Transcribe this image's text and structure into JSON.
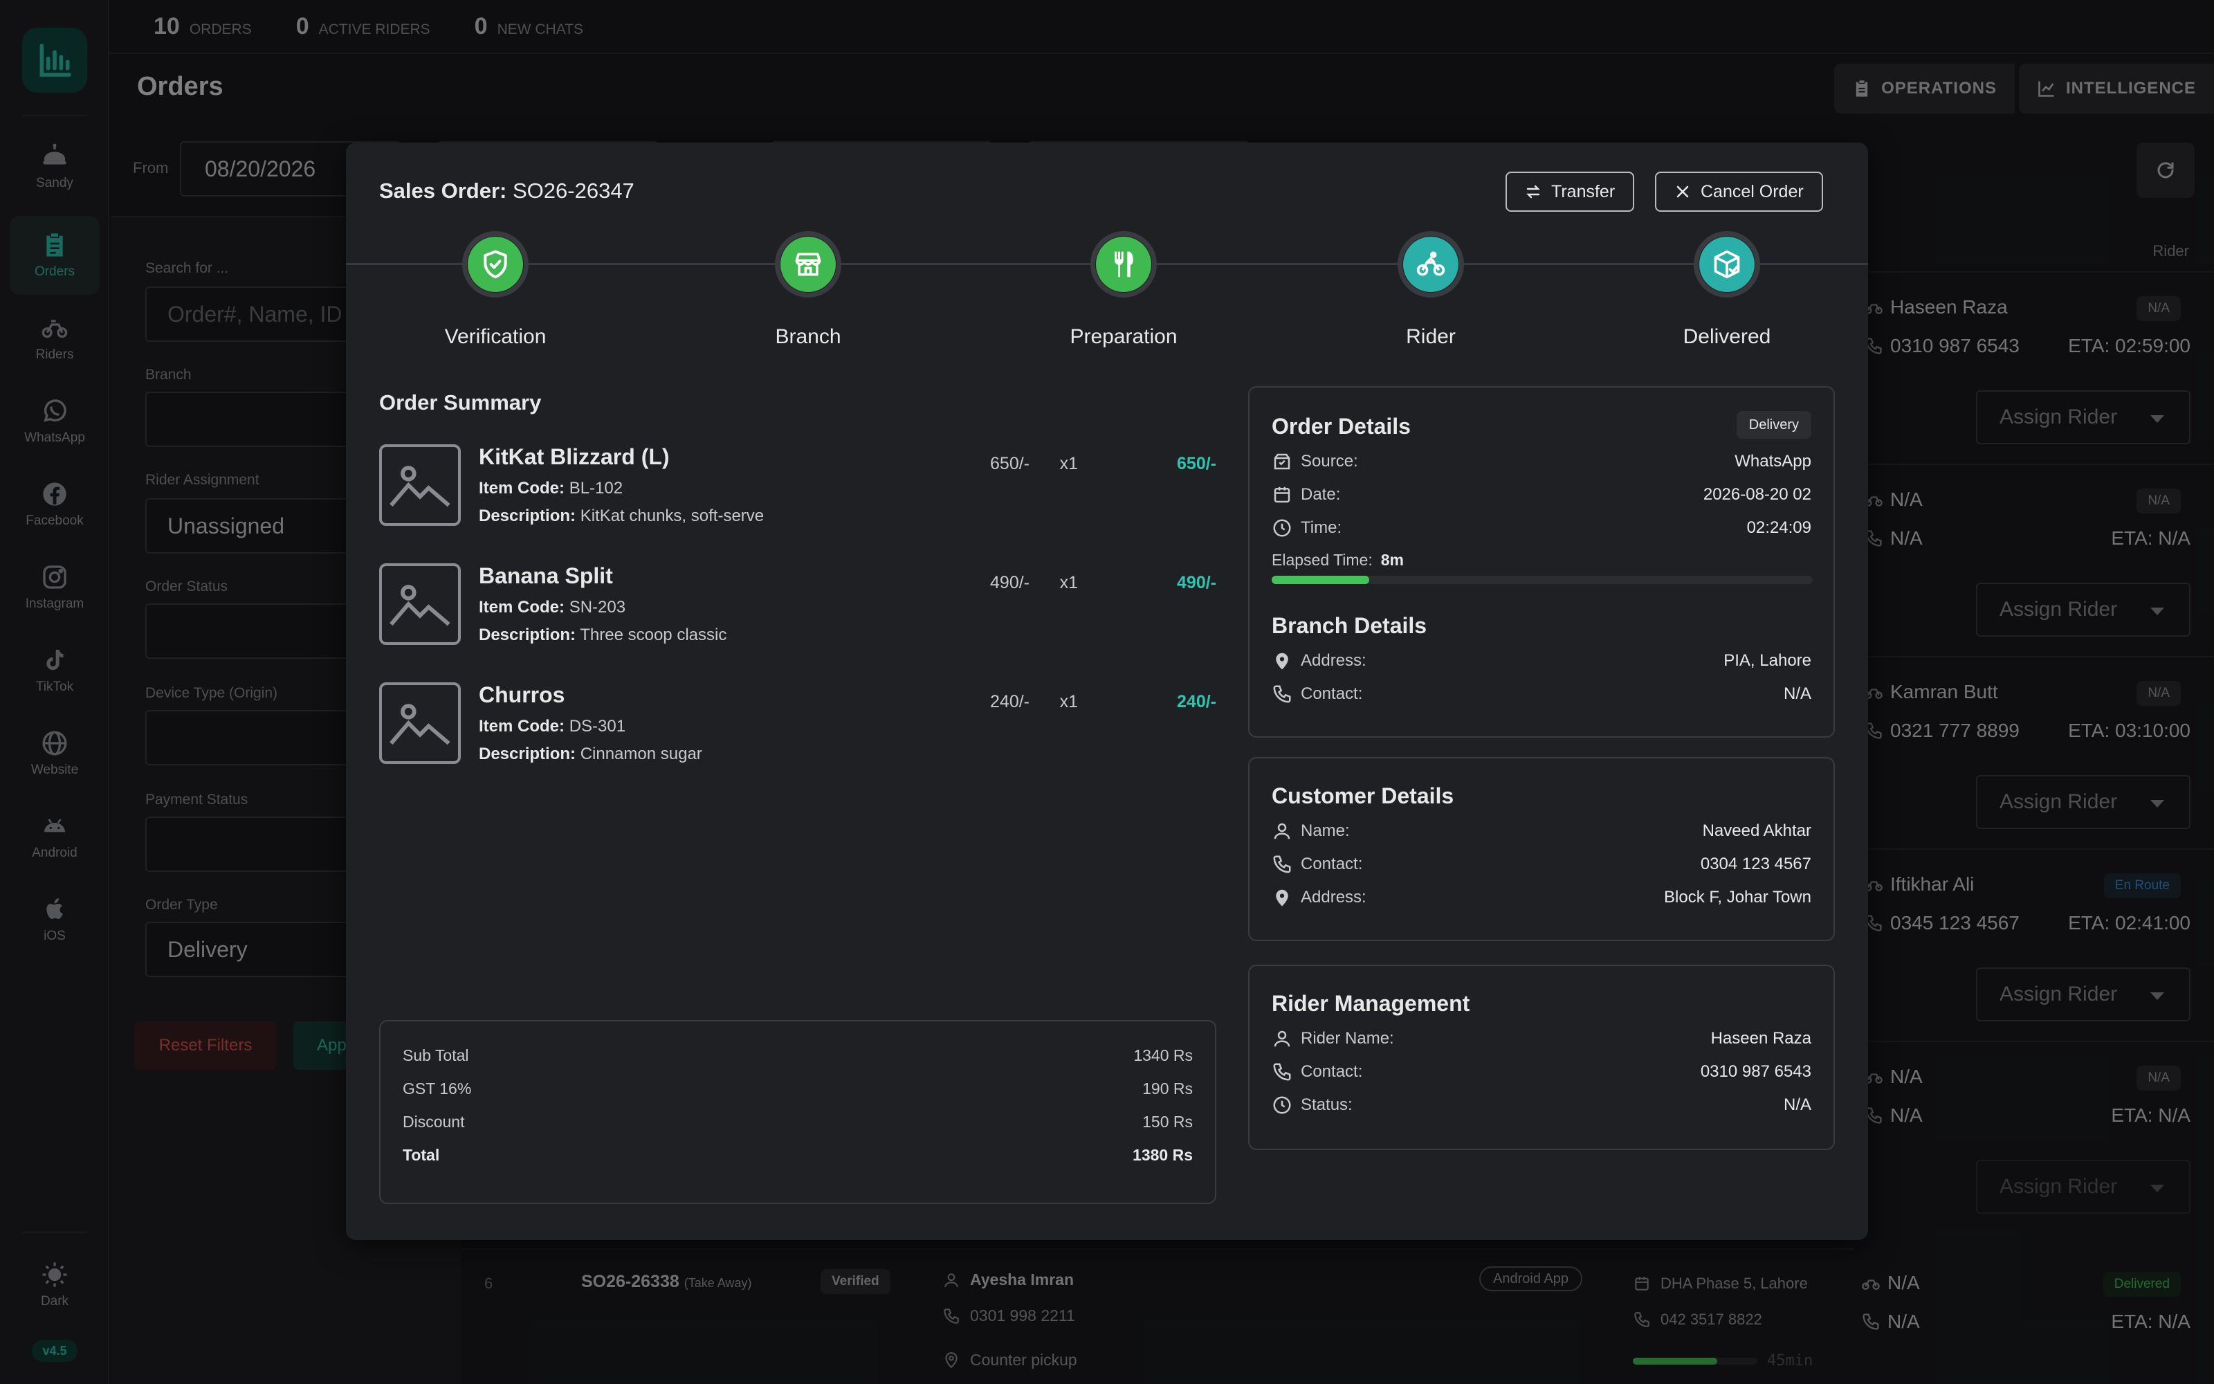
{
  "brand_color": "#2ec4b0",
  "sidebar": {
    "items": [
      {
        "id": "sandy",
        "label": "Sandy",
        "icon": "robot-icon"
      },
      {
        "id": "orders",
        "label": "Orders",
        "icon": "clipboard-icon",
        "active": true
      },
      {
        "id": "riders",
        "label": "Riders",
        "icon": "bicycle-icon"
      },
      {
        "id": "whatsapp",
        "label": "WhatsApp",
        "icon": "whatsapp-icon"
      },
      {
        "id": "facebook",
        "label": "Facebook",
        "icon": "facebook-icon"
      },
      {
        "id": "instagram",
        "label": "Instagram",
        "icon": "instagram-icon"
      },
      {
        "id": "tiktok",
        "label": "TikTok",
        "icon": "tiktok-icon"
      },
      {
        "id": "website",
        "label": "Website",
        "icon": "globe-icon"
      },
      {
        "id": "android",
        "label": "Android",
        "icon": "android-icon"
      },
      {
        "id": "ios",
        "label": "iOS",
        "icon": "apple-icon"
      }
    ],
    "theme_label": "Dark",
    "version": "v4.5"
  },
  "stats": [
    {
      "value": "10",
      "label": "Orders"
    },
    {
      "value": "0",
      "label": "Active Riders"
    },
    {
      "value": "0",
      "label": "New Chats"
    }
  ],
  "header": {
    "title": "Orders",
    "operations_label": "OPERATIONS",
    "intelligence_label": "INTELLIGENCE"
  },
  "date_filter": {
    "from_label": "From",
    "from_value": "08/20/2026"
  },
  "filters": {
    "search_label": "Search for ...",
    "search_placeholder": "Order#, Name, ID",
    "branch_label": "Branch",
    "rider_label": "Rider Assignment",
    "rider_value": "Unassigned",
    "status_label": "Order Status",
    "device_label": "Device Type (Origin)",
    "payment_label": "Payment Status",
    "type_label": "Order Type",
    "type_value": "Delivery",
    "reset_label": "Reset Filters",
    "apply_label": "App"
  },
  "list": {
    "rider_col_label": "Rider",
    "assign_label": "Assign Rider",
    "rows": [
      {
        "rider": "Haseen Raza",
        "phone": "0310 987 6543",
        "eta": "ETA: 02:59:00",
        "badge": "N/A",
        "badge_kind": "na"
      },
      {
        "rider": "N/A",
        "phone": "N/A",
        "eta": "ETA: N/A",
        "badge": "N/A",
        "badge_kind": "na"
      },
      {
        "rider": "Kamran Butt",
        "phone": "0321 777 8899",
        "eta": "ETA: 03:10:00",
        "badge": "N/A",
        "badge_kind": "na"
      },
      {
        "rider": "Iftikhar Ali",
        "phone": "0345 123 4567",
        "eta": "ETA: 02:41:00",
        "badge": "En Route",
        "badge_kind": "enroute"
      },
      {
        "rider": "N/A",
        "phone": "N/A",
        "eta": "ETA: N/A",
        "badge": "N/A",
        "badge_kind": "na"
      }
    ],
    "bottom_row": {
      "index": "6",
      "order_no": "SO26-26338",
      "order_type": "(Take Away)",
      "status": "Verified",
      "customer": "Ayesha Imran",
      "phone": "0301 998 2211",
      "address": "Counter pickup",
      "source": "Android App",
      "branch": "DHA Phase 5, Lahore",
      "branch_phone": "042 3517 8822",
      "elapsed": "45min",
      "progress": 0.68,
      "rider": "N/A",
      "rider_phone": "N/A",
      "eta": "ETA: N/A",
      "badge": "Delivered"
    }
  },
  "modal": {
    "title_prefix": "Sales Order:",
    "order_no": "SO26-26347",
    "transfer_label": "Transfer",
    "cancel_label": "Cancel Order",
    "steps": [
      {
        "name": "Verification",
        "icon": "shield-check-icon",
        "color": "#3fb950"
      },
      {
        "name": "Branch",
        "icon": "store-icon",
        "color": "#3fb950"
      },
      {
        "name": "Preparation",
        "icon": "utensils-icon",
        "color": "#3fb950"
      },
      {
        "name": "Rider",
        "icon": "bike-icon",
        "color": "#2ab0a8"
      },
      {
        "name": "Delivered",
        "icon": "package-check-icon",
        "color": "#2ab0a8"
      }
    ],
    "summary_title": "Order Summary",
    "code_label": "Item Code:",
    "desc_label": "Description:",
    "items": [
      {
        "name": "KitKat Blizzard (L)",
        "code": "BL-102",
        "description": "KitKat chunks, soft-serve",
        "price": "650/-",
        "qty": "x1",
        "total": "650/-"
      },
      {
        "name": "Banana Split",
        "code": "SN-203",
        "description": "Three scoop classic",
        "price": "490/-",
        "qty": "x1",
        "total": "490/-"
      },
      {
        "name": "Churros",
        "code": "DS-301",
        "description": "Cinnamon sugar",
        "price": "240/-",
        "qty": "x1",
        "total": "240/-"
      }
    ],
    "totals": [
      {
        "label": "Sub Total",
        "value": "1340 Rs"
      },
      {
        "label": "GST 16%",
        "value": "190 Rs"
      },
      {
        "label": "Discount",
        "value": "150 Rs"
      },
      {
        "label": "Total",
        "value": "1380 Rs"
      }
    ],
    "order_details": {
      "title": "Order Details",
      "badge": "Delivery",
      "source_label": "Source:",
      "source": "WhatsApp",
      "date_label": "Date:",
      "date": "2026-08-20 02",
      "time_label": "Time:",
      "time": "02:24:09",
      "elapsed_label": "Elapsed Time:",
      "elapsed": "8m",
      "elapsed_progress": 0.18
    },
    "branch_details": {
      "title": "Branch Details",
      "address_label": "Address:",
      "address": "PIA, Lahore",
      "contact_label": "Contact:",
      "contact": "N/A"
    },
    "customer_details": {
      "title": "Customer Details",
      "name_label": "Name:",
      "name": "Naveed Akhtar",
      "contact_label": "Contact:",
      "contact": "0304 123 4567",
      "address_label": "Address:",
      "address": "Block F, Johar Town"
    },
    "rider_management": {
      "title": "Rider Management",
      "name_label": "Rider Name:",
      "name": "Haseen Raza",
      "contact_label": "Contact:",
      "contact": "0310 987 6543",
      "status_label": "Status:",
      "status": "N/A"
    }
  }
}
